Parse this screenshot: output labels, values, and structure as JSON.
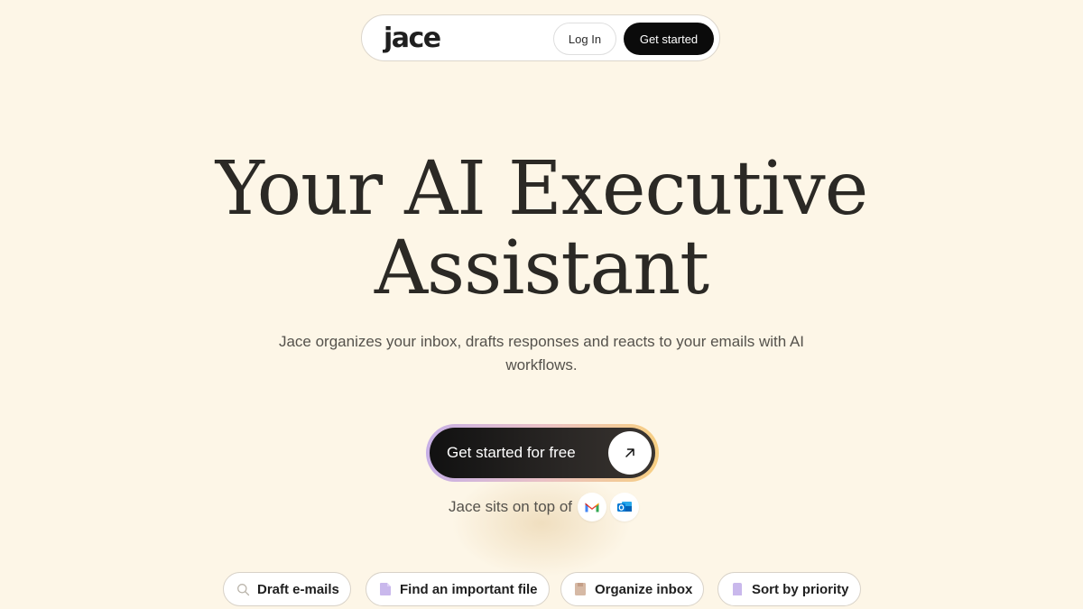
{
  "nav": {
    "brand": "jace",
    "login_label": "Log In",
    "get_started_label": "Get started"
  },
  "hero": {
    "title_line1": "Your AI Executive",
    "title_line2": "Assistant",
    "subtitle": "Jace organizes your inbox, drafts responses and reacts to your emails with AI workflows.",
    "cta_label": "Get started for free",
    "integrations_label": "Jace sits on top of",
    "integrations": [
      "gmail-icon",
      "outlook-icon"
    ]
  },
  "chips": [
    {
      "label": "Draft e-mails",
      "icon": "search-icon"
    },
    {
      "label": "Find an important file",
      "icon": "file-icon"
    },
    {
      "label": "Organize inbox",
      "icon": "folder-icon"
    },
    {
      "label": "Sort by priority",
      "icon": "priority-icon"
    }
  ],
  "colors": {
    "background": "#fdf6e7",
    "primary_button": "#0b0b0b",
    "cta_gradient_start": "#c7b0e6",
    "cta_gradient_end": "#f7cf82"
  }
}
